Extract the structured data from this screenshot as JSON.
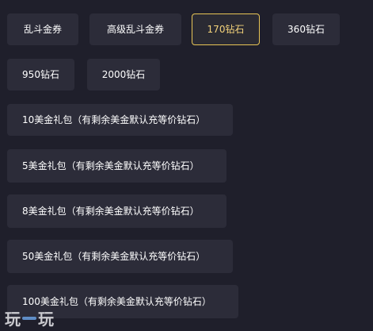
{
  "options": {
    "row1": [
      "乱斗金券",
      "高级乱斗金券",
      "170钻石",
      "360钻石"
    ],
    "row2": [
      "950钻石",
      "2000钻石"
    ],
    "packages": [
      "10美金礼包（有剩余美金默认充等价钻石）",
      "5美金礼包（有剩余美金默认充等价钻石）",
      "8美金礼包（有剩余美金默认充等价钻石）",
      "50美金礼包（有剩余美金默认充等价钻石）",
      "100美金礼包（有剩余美金默认充等价钻石）"
    ],
    "selected": "170钻石"
  },
  "watermark": {
    "left": "玩",
    "right": "玩"
  },
  "colors": {
    "background": "#1f1f2b",
    "button": "#2c2c39",
    "selected_border": "#e7c456",
    "selected_text": "#f3d27a"
  }
}
